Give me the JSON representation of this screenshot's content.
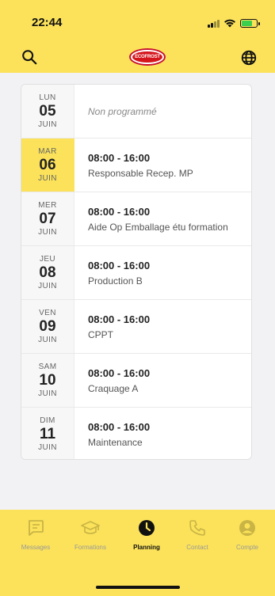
{
  "status_bar": {
    "time": "22:44"
  },
  "header": {
    "logo_text": "ECOFROST"
  },
  "planning": {
    "days": [
      {
        "dow": "LUN",
        "day": "05",
        "month": "JUIN",
        "hours": "",
        "role": "",
        "unscheduled": "Non programmé",
        "selected": false
      },
      {
        "dow": "MAR",
        "day": "06",
        "month": "JUIN",
        "hours": "08:00 - 16:00",
        "role": "Responsable Recep. MP",
        "unscheduled": "",
        "selected": true
      },
      {
        "dow": "MER",
        "day": "07",
        "month": "JUIN",
        "hours": "08:00 - 16:00",
        "role": "Aide Op Emballage étu formation",
        "unscheduled": "",
        "selected": false
      },
      {
        "dow": "JEU",
        "day": "08",
        "month": "JUIN",
        "hours": "08:00 - 16:00",
        "role": "Production B",
        "unscheduled": "",
        "selected": false
      },
      {
        "dow": "VEN",
        "day": "09",
        "month": "JUIN",
        "hours": "08:00 - 16:00",
        "role": "CPPT",
        "unscheduled": "",
        "selected": false
      },
      {
        "dow": "SAM",
        "day": "10",
        "month": "JUIN",
        "hours": "08:00 - 16:00",
        "role": "Craquage A",
        "unscheduled": "",
        "selected": false
      },
      {
        "dow": "DIM",
        "day": "11",
        "month": "JUIN",
        "hours": "08:00 - 16:00",
        "role": "Maintenance",
        "unscheduled": "",
        "selected": false
      }
    ]
  },
  "tabbar": {
    "tabs": [
      {
        "label": "Messages",
        "icon": "chat-icon",
        "active": false
      },
      {
        "label": "Formations",
        "icon": "graduation-cap-icon",
        "active": false
      },
      {
        "label": "Planning",
        "icon": "clock-icon",
        "active": true
      },
      {
        "label": "Contact",
        "icon": "phone-icon",
        "active": false
      },
      {
        "label": "Compte",
        "icon": "user-icon",
        "active": false
      }
    ]
  },
  "colors": {
    "brand_yellow": "#fbe25a",
    "logo_red": "#d4161c",
    "inactive_icon": "#c9b445"
  }
}
